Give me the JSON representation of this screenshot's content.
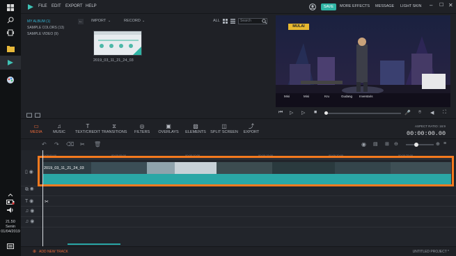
{
  "menu": {
    "file": "FILE",
    "edit": "EDIT",
    "export": "EXPORT",
    "help": "HELP"
  },
  "topbar": {
    "save": "SAVE",
    "more_effects": "MORE EFFECTS",
    "message": "MESSAGE",
    "skin": "LIGHT SKIN"
  },
  "library": {
    "albums": [
      "MY ALBUM (1)",
      "SAMPLE COLORS (13)",
      "SAMPLE VIDEO (9)"
    ],
    "import": "IMPORT",
    "record": "RECORD",
    "filter_all": "ALL",
    "search_placeholder": "Search",
    "media_item": "2019_03_11_21_24_03"
  },
  "preview": {
    "game_button": "MULAI",
    "menu_items": [
      "Misi",
      "Misi",
      "Kru",
      "Gudang",
      "Inventaris"
    ]
  },
  "modules": [
    "MEDIA",
    "MUSIC",
    "TEXT/CREDIT",
    "TRANSITIONS",
    "FILTERS",
    "OVERLAYS",
    "ELEMENTS",
    "SPLIT SCREEN",
    "EXPORT"
  ],
  "aspect_ratio": "ASPECT RATIO: 16:9",
  "timecode": "00:00:00.00",
  "ruler_ticks": [
    "00:00:00:00",
    "00:00:05:00",
    "00:00:10:00",
    "00:00:15:00",
    "00:00:20:00",
    "00:00:25:00",
    "00:00:30:00",
    "00:00:35:00",
    "00:00:40:00",
    "00:00:45:00"
  ],
  "timeline": {
    "clip_name": "2019_03_11_21_24_03"
  },
  "bottom": {
    "add_track": "ADD NEW TRACK",
    "project": "UNTITLED PROJECT *"
  },
  "taskbar": {
    "time": "21.50",
    "day": "Senin",
    "date": "01/04/2019"
  },
  "colors": {
    "accent": "#2fb5a5",
    "active_module": "#ea6a3a",
    "highlight": "#f47a1f",
    "audio": "#2aa7a6"
  }
}
